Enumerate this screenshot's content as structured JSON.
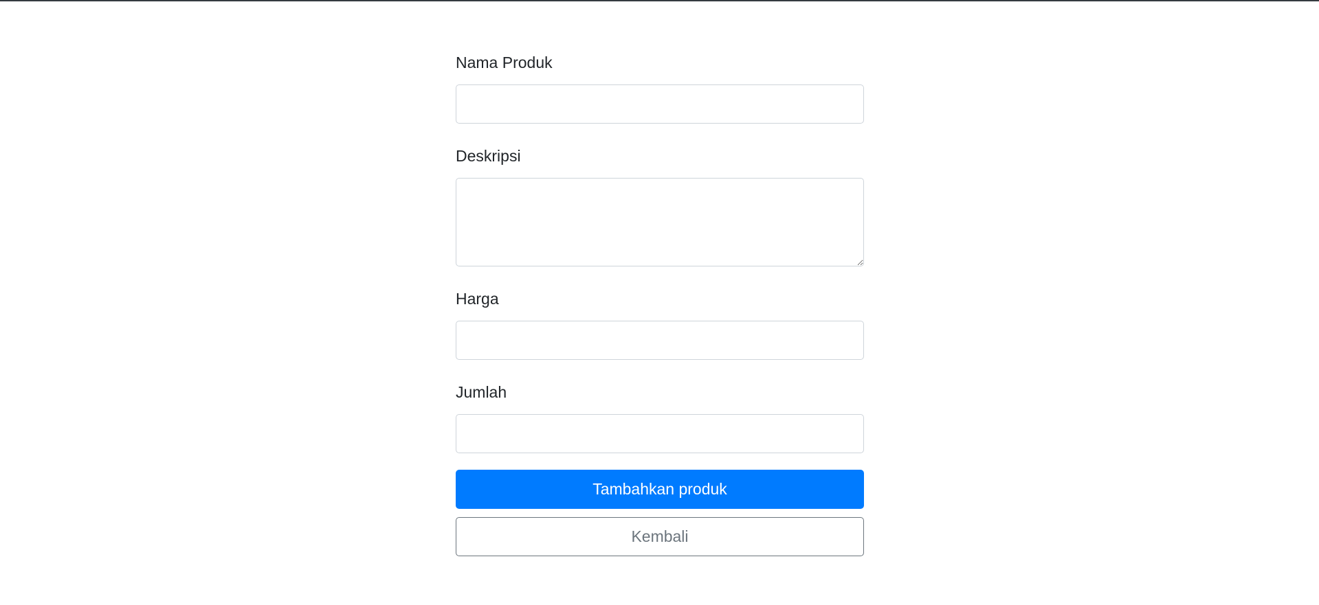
{
  "form": {
    "fields": {
      "nama_produk": {
        "label": "Nama Produk",
        "value": "",
        "placeholder": ""
      },
      "deskripsi": {
        "label": "Deskripsi",
        "value": "",
        "placeholder": ""
      },
      "harga": {
        "label": "Harga",
        "value": "",
        "placeholder": ""
      },
      "jumlah": {
        "label": "Jumlah",
        "value": "",
        "placeholder": ""
      }
    },
    "submit_label": "Tambahkan produk",
    "back_label": "Kembali"
  },
  "colors": {
    "primary": "#007bff",
    "secondary": "#6c757d",
    "top_border": "#343a40"
  }
}
